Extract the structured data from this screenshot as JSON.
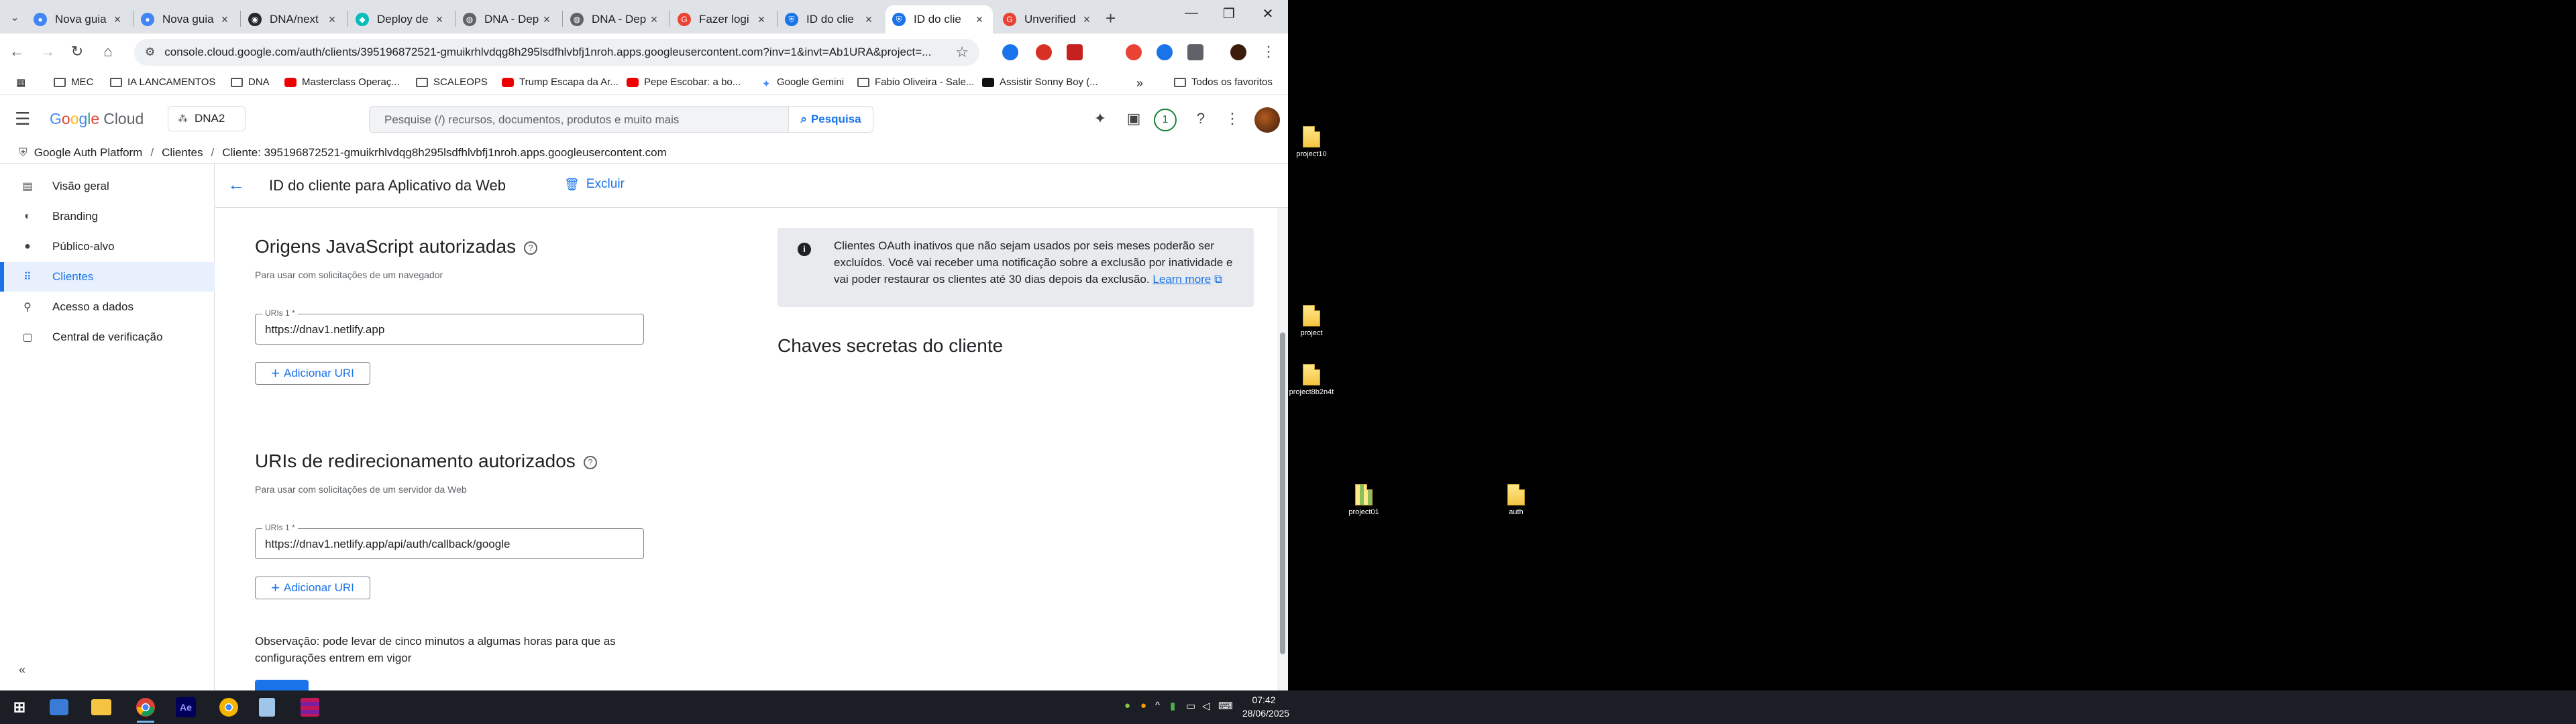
{
  "browser": {
    "tabs": [
      {
        "title": "Nova guia",
        "favicon": "chrome-icon"
      },
      {
        "title": "Nova guia",
        "favicon": "chrome-icon"
      },
      {
        "title": "DNA/next",
        "favicon": "github-icon"
      },
      {
        "title": "Deploy de",
        "favicon": "netlify-icon"
      },
      {
        "title": "DNA - Dep",
        "favicon": "globe-icon"
      },
      {
        "title": "DNA - Dep",
        "favicon": "globe-icon"
      },
      {
        "title": "Fazer logi",
        "favicon": "google-icon"
      },
      {
        "title": "ID do clie",
        "favicon": "shield-icon"
      },
      {
        "title": "ID do clie",
        "favicon": "shield-icon"
      },
      {
        "title": "Unverified",
        "favicon": "google-icon"
      }
    ],
    "url": "console.cloud.google.com/auth/clients/395196872521-gmuikrhlvdqg8h295lsdfhlvbfj1nroh.apps.googleusercontent.com?inv=1&invt=Ab1URA&project=...",
    "bookmarks": [
      {
        "label": "MEC",
        "icon": "folder-icon"
      },
      {
        "label": "IA LANCAMENTOS",
        "icon": "folder-icon"
      },
      {
        "label": "DNA",
        "icon": "folder-icon"
      },
      {
        "label": "Masterclass Operaç...",
        "icon": "youtube-icon"
      },
      {
        "label": "SCALEOPS",
        "icon": "folder-icon"
      },
      {
        "label": "Trump Escapa da Ar...",
        "icon": "youtube-icon"
      },
      {
        "label": "Pepe Escobar: a bo...",
        "icon": "youtube-icon"
      },
      {
        "label": "Google Gemini",
        "icon": "gemini-icon"
      },
      {
        "label": "Fabio Oliveira - Sale...",
        "icon": "folder-icon"
      },
      {
        "label": "Assistir Sonny Boy (...",
        "icon": "play-icon"
      }
    ],
    "bookmarks_more": "»",
    "all_bookmarks": "Todos os favoritos"
  },
  "gcp": {
    "logo_letters": [
      "G",
      "o",
      "o",
      "g",
      "l",
      "e"
    ],
    "logo_cloud": "Cloud",
    "project": "DNA2",
    "search_placeholder": "Pesquise (/) recursos, documentos, produtos e muito mais",
    "search_button": "Pesquisa",
    "notifications_count": "1"
  },
  "breadcrumb": {
    "items": [
      "Google Auth Platform",
      "Clientes",
      "Cliente: 395196872521-gmuikrhlvdqg8h295lsdfhlvbfj1nroh.apps.googleusercontent.com"
    ]
  },
  "sidebar": {
    "items": [
      {
        "label": "Visão geral",
        "icon": "dashboard-icon"
      },
      {
        "label": "Branding",
        "icon": "palette-icon"
      },
      {
        "label": "Público-alvo",
        "icon": "person-icon"
      },
      {
        "label": "Clientes",
        "icon": "grid-icon",
        "active": true
      },
      {
        "label": "Acesso a dados",
        "icon": "data-access-icon"
      },
      {
        "label": "Central de verificação",
        "icon": "verification-icon"
      }
    ]
  },
  "main": {
    "page_title": "ID do cliente para Aplicativo da Web",
    "delete_label": "Excluir",
    "js_origins": {
      "title": "Origens JavaScript autorizadas",
      "subtitle": "Para usar com solicitações de um navegador",
      "field_label": "URIs 1 *",
      "field_value": "https://dnav1.netlify.app",
      "add_label": "Adicionar URI"
    },
    "redirects": {
      "title": "URIs de redirecionamento autorizados",
      "subtitle": "Para usar com solicitações de um servidor da Web",
      "field_label": "URIs 1 *",
      "field_value": "https://dnav1.netlify.app/api/auth/callback/google",
      "add_label": "Adicionar URI"
    },
    "note": "Observação: pode levar de cinco minutos a algumas horas para que as configurações entrem em vigor",
    "info_text": "Clientes OAuth inativos que não sejam usados por seis meses poderão ser excluídos. Você vai receber uma notificação sobre a exclusão por inatividade e vai poder restaurar os clientes até 30 dias depois da exclusão.",
    "info_link": "Learn more",
    "secrets_title": "Chaves secretas do cliente"
  },
  "desktop": {
    "icons": [
      {
        "label": "project10",
        "type": "file"
      },
      {
        "label": "project",
        "type": "file"
      },
      {
        "label": "project8b2n4t",
        "type": "file"
      },
      {
        "label": "project01",
        "type": "zip"
      },
      {
        "label": "auth",
        "type": "file"
      }
    ]
  },
  "taskbar": {
    "apps": [
      "windows-start-icon",
      "monitor-icon",
      "file-explorer-icon",
      "chrome-icon",
      "after-effects-icon",
      "chrome-alt-icon",
      "notepad-icon",
      "winrar-icon"
    ],
    "ae_label": "Ae",
    "time": "07:42",
    "date": "28/06/2025"
  },
  "colors": {
    "accent": "#1a73e8",
    "active_nav_bg": "#e8f0fe",
    "info_bg": "#e8eaed",
    "taskbar_bg": "#1b1e24"
  }
}
